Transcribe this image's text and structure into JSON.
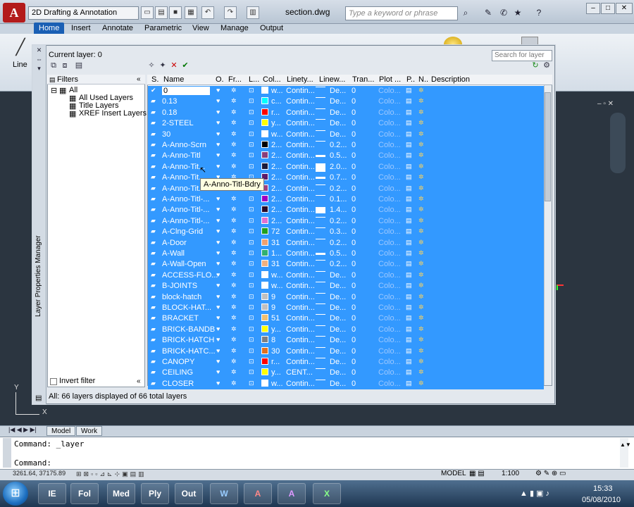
{
  "app": {
    "logo": "A",
    "workspace": "2D Drafting & Annotation",
    "document_title": "section.dwg",
    "search_placeholder": "Type a keyword or phrase"
  },
  "ribbon": {
    "tabs": [
      {
        "label": "Home",
        "active": true
      },
      {
        "label": "Insert"
      },
      {
        "label": "Annotate"
      },
      {
        "label": "Parametric"
      },
      {
        "label": "View"
      },
      {
        "label": "Manage"
      },
      {
        "label": "Output"
      }
    ],
    "line_label": "Line"
  },
  "palette": {
    "vertical_title": "Layer Properties Manager",
    "current_layer": "Current layer: 0",
    "search_placeholder": "Search for layer",
    "filters_title": "Filters",
    "tree": [
      "All",
      "All Used Layers",
      "Title Layers",
      "XREF Insert Layers"
    ],
    "invert_filter": "Invert filter",
    "status": "All: 66 layers displayed of 66 total layers",
    "tooltip": "A-Anno-Titl-Bdry",
    "columns": [
      "S.",
      "Name",
      "O.",
      "Fr...",
      "L...",
      "Col...",
      "Linety...",
      "Linew...",
      "Tran...",
      "Plot ...",
      "P..",
      "N..",
      "Description"
    ],
    "rows": [
      {
        "name": "0",
        "color": "#ffffff",
        "color_name": "w...",
        "linetype": "Contin...",
        "lineweight": "De...",
        "trans": "0",
        "plot": "Colo...",
        "current": true,
        "heavy": false
      },
      {
        "name": "0.13",
        "color": "#00ffff",
        "color_name": "c...",
        "linetype": "Contin...",
        "lineweight": "De...",
        "trans": "0",
        "plot": "Colo...",
        "heavy": false
      },
      {
        "name": "0.18",
        "color": "#ff0000",
        "color_name": "r...",
        "linetype": "Contin...",
        "lineweight": "De...",
        "trans": "0",
        "plot": "Colo...",
        "heavy": false
      },
      {
        "name": "2-STEEL",
        "color": "#ffff00",
        "color_name": "y...",
        "linetype": "Contin...",
        "lineweight": "De...",
        "trans": "0",
        "plot": "Colo...",
        "heavy": false
      },
      {
        "name": "30",
        "color": "#ffffff",
        "color_name": "w...",
        "linetype": "Contin...",
        "lineweight": "De...",
        "trans": "0",
        "plot": "Colo...",
        "heavy": false
      },
      {
        "name": "A-Anno-Scrn",
        "color": "#000000",
        "color_name": "2...",
        "linetype": "Contin...",
        "lineweight": "0.2...",
        "trans": "0",
        "plot": "Colo...",
        "heavy": false
      },
      {
        "name": "A-Anno-Titl",
        "color": "#8a3d7a",
        "color_name": "2...",
        "linetype": "Contin...",
        "lineweight": "0.5...",
        "trans": "0",
        "plot": "Colo...",
        "heavy": true
      },
      {
        "name": "A-Anno-Tit...",
        "color": "#1a1a3a",
        "color_name": "2...",
        "linetype": "Contin...",
        "lineweight": "2.0...",
        "trans": "0",
        "plot": "Colo...",
        "heavy": true
      },
      {
        "name": "A-Anno-Tit...",
        "color": "#5a1a6a",
        "color_name": "2...",
        "linetype": "Contin...",
        "lineweight": "0.7...",
        "trans": "0",
        "plot": "Colo...",
        "heavy": true
      },
      {
        "name": "A-Anno-Tit...",
        "color": "#a04080",
        "color_name": "2...",
        "linetype": "Contin...",
        "lineweight": "0.2...",
        "trans": "0",
        "plot": "Colo...",
        "heavy": false
      },
      {
        "name": "A-Anno-Titl-...",
        "color": "#a000c0",
        "color_name": "2...",
        "linetype": "Contin...",
        "lineweight": "0.1...",
        "trans": "0",
        "plot": "Colo...",
        "heavy": false
      },
      {
        "name": "A-Anno-Titl-...",
        "color": "#2a0a2a",
        "color_name": "2...",
        "linetype": "Contin...",
        "lineweight": "1.4...",
        "trans": "0",
        "plot": "Colo...",
        "heavy": true
      },
      {
        "name": "A-Anno-Titl-...",
        "color": "#e070d0",
        "color_name": "2...",
        "linetype": "Contin...",
        "lineweight": "0.2...",
        "trans": "0",
        "plot": "Colo...",
        "heavy": false
      },
      {
        "name": "A-Clng-Grid",
        "color": "#20a020",
        "color_name": "72",
        "linetype": "Contin...",
        "lineweight": "0.3...",
        "trans": "0",
        "plot": "Colo...",
        "heavy": false
      },
      {
        "name": "A-Door",
        "color": "#f0a070",
        "color_name": "31",
        "linetype": "Contin...",
        "lineweight": "0.2...",
        "trans": "0",
        "plot": "Colo...",
        "heavy": false
      },
      {
        "name": "A-Wall",
        "color": "#30b070",
        "color_name": "1...",
        "linetype": "Contin...",
        "lineweight": "0.5...",
        "trans": "0",
        "plot": "Colo...",
        "heavy": true
      },
      {
        "name": "A-Wall-Open",
        "color": "#f0b080",
        "color_name": "31",
        "linetype": "Contin...",
        "lineweight": "0.2...",
        "trans": "0",
        "plot": "Colo...",
        "heavy": false
      },
      {
        "name": "ACCESS-FLO...",
        "color": "#ffffff",
        "color_name": "w...",
        "linetype": "Contin...",
        "lineweight": "De...",
        "trans": "0",
        "plot": "Colo...",
        "heavy": false
      },
      {
        "name": "B-JOINTS",
        "color": "#ffffff",
        "color_name": "w...",
        "linetype": "Contin...",
        "lineweight": "De...",
        "trans": "0",
        "plot": "Colo...",
        "heavy": false
      },
      {
        "name": "block-hatch",
        "color": "#c0c0c0",
        "color_name": "9",
        "linetype": "Contin...",
        "lineweight": "De...",
        "trans": "0",
        "plot": "Colo...",
        "heavy": false
      },
      {
        "name": "BLOCK-HAT...",
        "color": "#c0c0c0",
        "color_name": "9",
        "linetype": "Contin...",
        "lineweight": "De...",
        "trans": "0",
        "plot": "Colo...",
        "heavy": false
      },
      {
        "name": "BRACKET",
        "color": "#f0c070",
        "color_name": "51",
        "linetype": "Contin...",
        "lineweight": "De...",
        "trans": "0",
        "plot": "Colo...",
        "heavy": false
      },
      {
        "name": "BRICK-BANDB",
        "color": "#ffff00",
        "color_name": "y...",
        "linetype": "Contin...",
        "lineweight": "De...",
        "trans": "0",
        "plot": "Colo...",
        "heavy": false
      },
      {
        "name": "BRICK-HATCH",
        "color": "#808080",
        "color_name": "8",
        "linetype": "Contin...",
        "lineweight": "De...",
        "trans": "0",
        "plot": "Colo...",
        "heavy": false
      },
      {
        "name": "BRICK-HATC...",
        "color": "#e07020",
        "color_name": "30",
        "linetype": "Contin...",
        "lineweight": "De...",
        "trans": "0",
        "plot": "Colo...",
        "heavy": false
      },
      {
        "name": "CANOPY",
        "color": "#ff0000",
        "color_name": "r...",
        "linetype": "Contin...",
        "lineweight": "De...",
        "trans": "0",
        "plot": "Colo...",
        "heavy": false
      },
      {
        "name": "CEILING",
        "color": "#ffff00",
        "color_name": "y...",
        "linetype": "CENT...",
        "lineweight": "De...",
        "trans": "0",
        "plot": "Colo...",
        "heavy": false
      },
      {
        "name": "CLOSER",
        "color": "#ffffff",
        "color_name": "w...",
        "linetype": "Contin...",
        "lineweight": "De...",
        "trans": "0",
        "plot": "Colo...",
        "heavy": false
      }
    ]
  },
  "layout_tabs": [
    "Model",
    "Work"
  ],
  "command": {
    "line1": "Command: _layer",
    "line2": "Command:"
  },
  "status": {
    "coords": "3261.64, 37175.89",
    "model": "MODEL",
    "scale": "1:100"
  },
  "taskbar": {
    "apps": [
      "IE",
      "Fol",
      "Med",
      "Ply",
      "Out",
      "W",
      "A",
      "A",
      "X"
    ],
    "time": "15:33",
    "date": "05/08/2010"
  }
}
